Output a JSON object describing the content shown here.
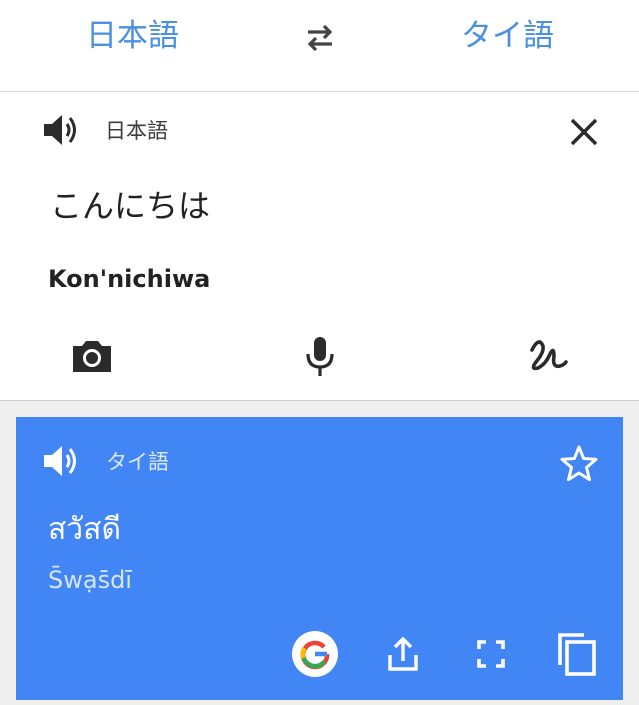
{
  "header": {
    "source_language": "日本語",
    "target_language": "タイ語",
    "swap_icon": "swap-arrows-icon"
  },
  "input_card": {
    "language_label": "日本語",
    "text": "こんにちは",
    "romanization": "Kon'nichiwa",
    "icons": [
      "speaker-icon",
      "close-icon",
      "camera-icon",
      "microphone-icon",
      "handwriting-icon"
    ]
  },
  "result_card": {
    "language_label": "タイ語",
    "text": "สวัสดี",
    "transliteration": "S̄wạs̄dī",
    "icons": [
      "speaker-icon",
      "star-icon",
      "google-icon",
      "share-icon",
      "fullscreen-icon",
      "copy-icon"
    ]
  },
  "colors": {
    "accent": "#4a90e2",
    "result_background": "#4285f4",
    "page_background": "#eeeeee"
  }
}
